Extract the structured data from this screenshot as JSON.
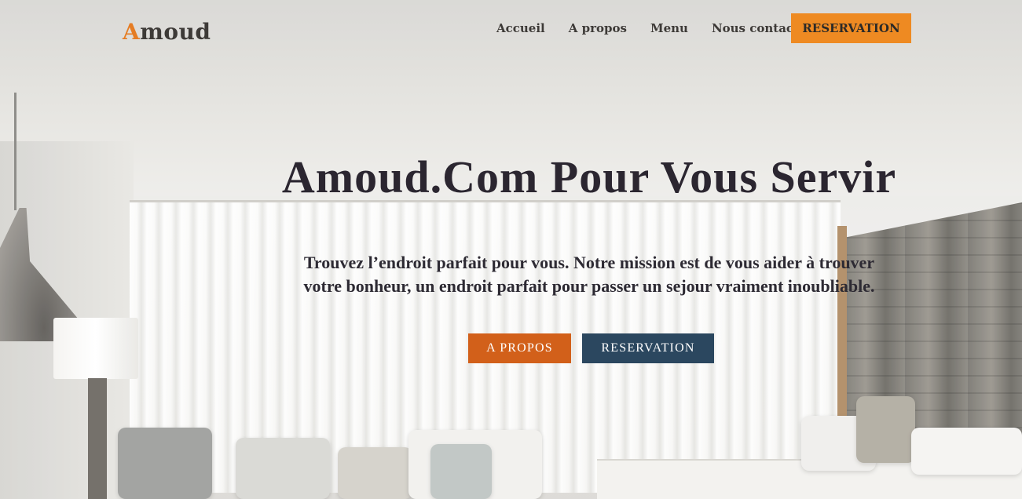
{
  "brand": {
    "first_letter": "A",
    "rest": "moud"
  },
  "nav": {
    "items": [
      {
        "label": "Accueil"
      },
      {
        "label": "A propos"
      },
      {
        "label": "Menu"
      },
      {
        "label": "Nous contacter"
      }
    ],
    "cta_label": "RESERVATION"
  },
  "hero": {
    "title": "Amoud.Com Pour Vous Servir",
    "line1": "Trouvez l’endroit parfait pour vous. Notre mission est de vous aider à trouver",
    "line2": "votre bonheur, un endroit parfait pour passer un sejour vraiment inoubliable.",
    "about_button": "A PROPOS",
    "reserve_button": "RESERVATION"
  },
  "colors": {
    "accent_orange": "#ee8a22",
    "about_button": "#d2601a",
    "reserve_button": "#2b475f",
    "text_dark": "#2b2630"
  }
}
